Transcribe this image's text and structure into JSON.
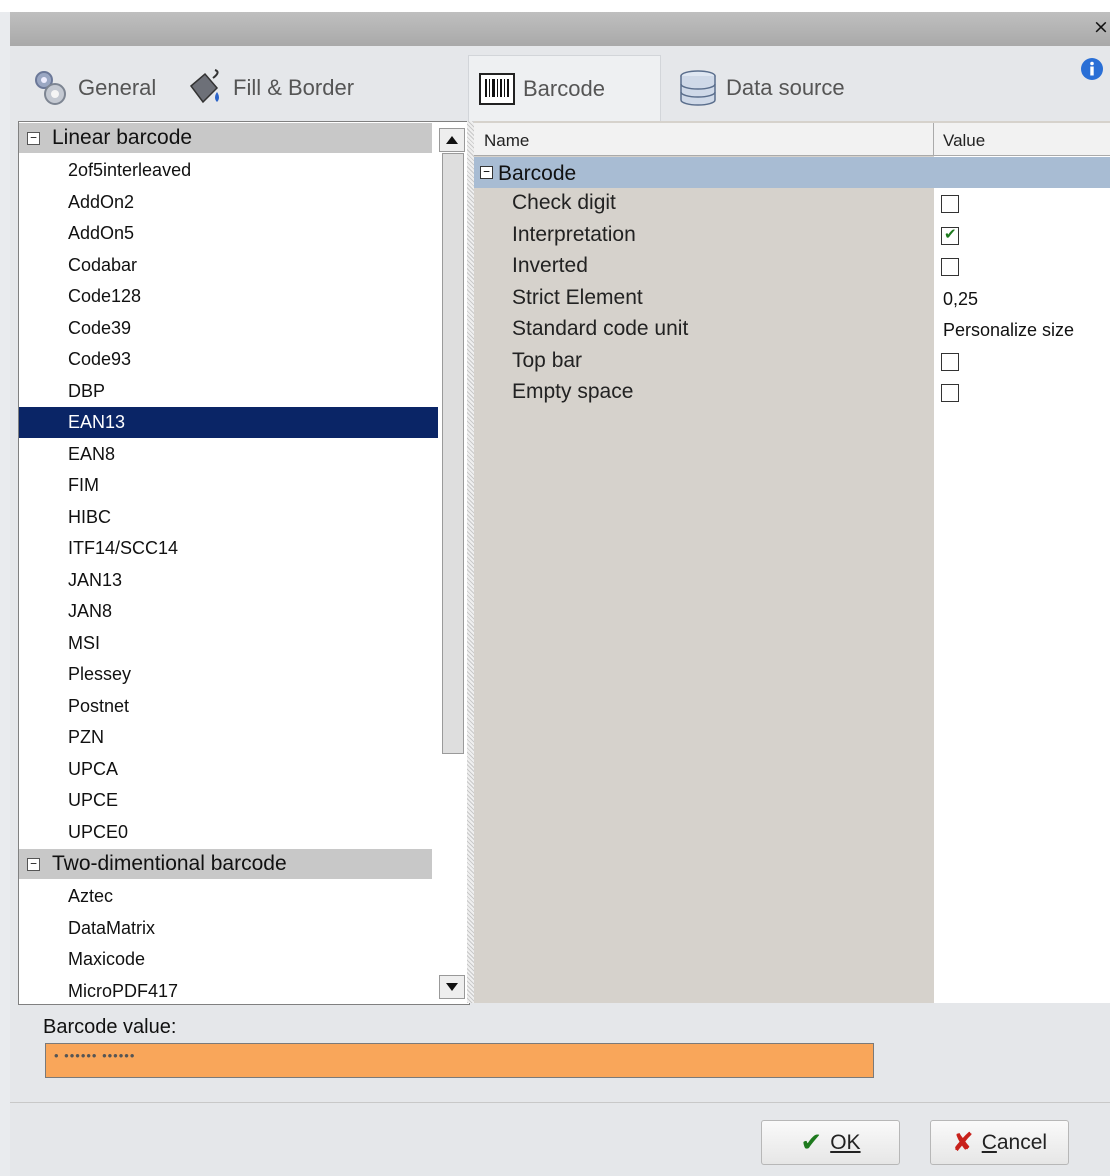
{
  "window": {
    "close_glyph": "×"
  },
  "tabs": [
    {
      "label": "General",
      "icon": "gears-icon"
    },
    {
      "label": "Fill & Border",
      "icon": "paint-bucket-icon"
    },
    {
      "label": "Barcode",
      "icon": "barcode-icon",
      "active": true
    },
    {
      "label": "Data source",
      "icon": "database-icon"
    }
  ],
  "info_icon": "info-icon",
  "barcode_list": {
    "groups": [
      {
        "label": "Linear barcode",
        "items": [
          "2of5interleaved",
          "AddOn2",
          "AddOn5",
          "Codabar",
          "Code128",
          "Code39",
          "Code93",
          "DBP",
          "EAN13",
          "EAN8",
          "FIM",
          "HIBC",
          "ITF14/SCC14",
          "JAN13",
          "JAN8",
          "MSI",
          "Plessey",
          "Postnet",
          "PZN",
          "UPCA",
          "UPCE",
          "UPCE0"
        ]
      },
      {
        "label": "Two-dimentional barcode",
        "items": [
          "Aztec",
          "DataMatrix",
          "Maxicode",
          "MicroPDF417"
        ]
      }
    ],
    "selected": "EAN13"
  },
  "property_grid": {
    "col_name": "Name",
    "col_value": "Value",
    "category": "Barcode",
    "rows": [
      {
        "name": "Check digit",
        "type": "checkbox",
        "checked": false
      },
      {
        "name": "Interpretation",
        "type": "checkbox",
        "checked": true
      },
      {
        "name": "Inverted",
        "type": "checkbox",
        "checked": false
      },
      {
        "name": "Strict Element",
        "type": "text",
        "value": "0,25"
      },
      {
        "name": "Standard code unit",
        "type": "text",
        "value": "Personalize size"
      },
      {
        "name": "Top bar",
        "type": "checkbox",
        "checked": false
      },
      {
        "name": "Empty space",
        "type": "checkbox",
        "checked": false
      }
    ]
  },
  "barcode_value": {
    "label": "Barcode value:",
    "value": "• •••••• ••••••"
  },
  "buttons": {
    "ok": "OK",
    "cancel": "Cancel"
  },
  "colors": {
    "selection": "#0a2566",
    "input_bg": "#f9a65a",
    "category_row": "#a8bcd3"
  }
}
